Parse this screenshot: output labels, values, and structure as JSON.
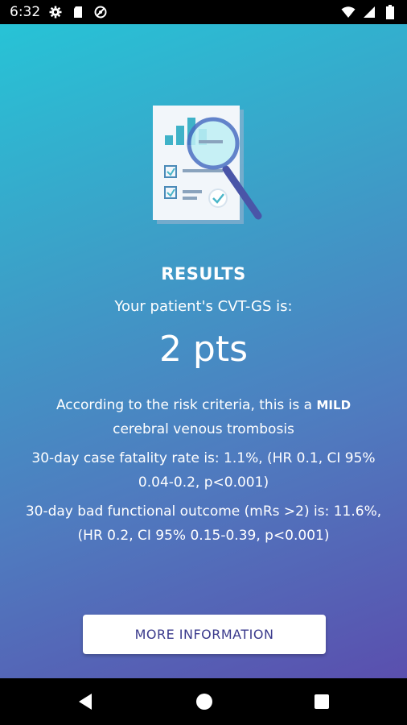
{
  "status_bar": {
    "time": "6:32",
    "left_icons": [
      "gear-icon",
      "sd-card-icon",
      "blocked-circle-icon"
    ],
    "right_icons": [
      "wifi-icon",
      "cell-signal-icon",
      "battery-icon"
    ]
  },
  "results": {
    "title": "RESULTS",
    "subtitle": "Your patient's CVT-GS is:",
    "score": "2 pts",
    "criteria_prefix": "According to the risk criteria, this is a ",
    "severity": "MILD",
    "criteria_suffix": "cerebral venous trombosis",
    "fatality_text": "30-day case fatality rate is: 1.1%, (HR 0.1, CI 95% 0.04-0.2, p<0.001)",
    "outcome_text": "30-day bad functional outcome (mRs >2) is: 11.6%, (HR 0.2, CI 95% 0.15-0.39, p<0.001)"
  },
  "more_button_label": "MORE INFORMATION",
  "colors": {
    "gradient_top": "#27c3d6",
    "gradient_bottom": "#5a4fae",
    "button_text": "#3a3a8c"
  },
  "nav": {
    "icons": [
      "back-icon",
      "home-icon",
      "recents-icon"
    ]
  }
}
